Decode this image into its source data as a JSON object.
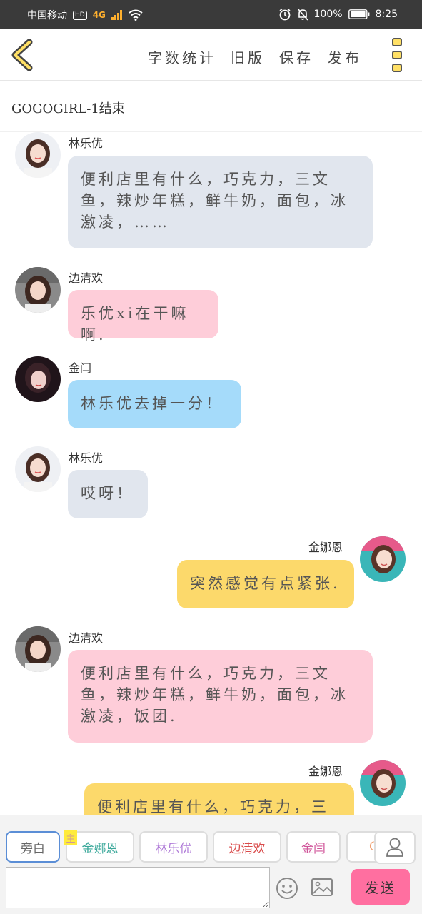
{
  "status_bar": {
    "carrier": "中国移动",
    "hd": "HD",
    "network": "4G",
    "battery": "100%",
    "time": "8:25"
  },
  "toolbar": {
    "actions": [
      "字数统计",
      "旧版",
      "保存",
      "发布"
    ]
  },
  "story_title": "GOGOGIRL-1结束",
  "messages": [
    {
      "speaker": "林乐优",
      "text": "便利店里有什么，巧克力，三文鱼，辣炒年糕，鲜牛奶，面包，冰激凌，……",
      "side": "left",
      "color": "#e1e6ee"
    },
    {
      "speaker": "边清欢",
      "text": "乐优xi在干嘛啊.",
      "side": "left",
      "color": "#fecdd9"
    },
    {
      "speaker": "金闫",
      "text": "林乐优去掉一分！",
      "side": "left",
      "color": "#a5dbfa"
    },
    {
      "speaker": "林乐优",
      "text": "哎呀！",
      "side": "left",
      "color": "#e1e6ee"
    },
    {
      "speaker": "金娜恩",
      "text": "突然感觉有点紧张.",
      "side": "right",
      "color": "#fcd96b"
    },
    {
      "speaker": "边清欢",
      "text": "便利店里有什么，巧克力，三文鱼，辣炒年糕，鲜牛奶，面包，冰激凌，饭团.",
      "side": "left",
      "color": "#fecdd9"
    },
    {
      "speaker": "金娜恩",
      "text": "便利店里有什么，巧克力，三",
      "side": "right",
      "color": "#fcd96b"
    }
  ],
  "role_chips": [
    {
      "label": "旁白",
      "color": "#666666"
    },
    {
      "label": "金娜恩",
      "color": "#3aa89a",
      "badge": "主"
    },
    {
      "label": "林乐优",
      "color": "#b07cd8"
    },
    {
      "label": "边清欢",
      "color": "#d94a4a"
    },
    {
      "label": "金闫",
      "color": "#d0559a"
    },
    {
      "label": "GIF",
      "color": "#f0a070"
    }
  ],
  "composer": {
    "placeholder": "",
    "send_label": "发送"
  }
}
